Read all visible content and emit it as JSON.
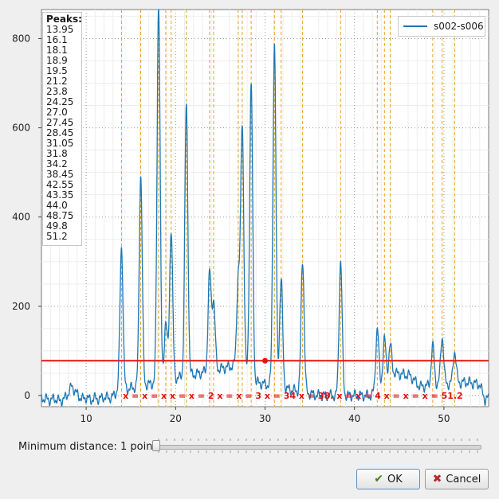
{
  "chart_data": {
    "type": "line",
    "series": [
      {
        "name": "s002-s006",
        "color": "#1f77b4"
      }
    ],
    "xlim": [
      5,
      55
    ],
    "ylim": [
      -25,
      865
    ],
    "x_ticks": [
      10,
      20,
      30,
      40,
      50
    ],
    "y_ticks": [
      0,
      200,
      400,
      600,
      800
    ],
    "grid": true,
    "legend_position": "top-right",
    "threshold": 78,
    "threshold_marker_x": 30,
    "threshold_color": "#e8140f",
    "peak_line_color": "#e6a21c",
    "baseline_points": [
      [
        5,
        -5
      ],
      [
        5.5,
        -8
      ],
      [
        6,
        -10
      ],
      [
        6.5,
        -7
      ],
      [
        7,
        -12
      ],
      [
        7.5,
        -9
      ],
      [
        8,
        5
      ],
      [
        8.4,
        22
      ],
      [
        8.8,
        8
      ],
      [
        9.2,
        -2
      ],
      [
        9.6,
        -8
      ],
      [
        10,
        -4
      ],
      [
        10.5,
        -10
      ],
      [
        11,
        -6
      ],
      [
        11.5,
        -8
      ],
      [
        12,
        -3
      ],
      [
        12.5,
        -6
      ],
      [
        13,
        -2
      ],
      [
        13.5,
        10
      ],
      [
        27.3,
        70
      ],
      [
        28.9,
        30
      ],
      [
        40.2,
        -18
      ],
      [
        41.2,
        -12
      ],
      [
        44.5,
        50
      ],
      [
        46.2,
        45
      ],
      [
        47.3,
        20
      ],
      [
        52.5,
        30
      ],
      [
        54,
        25
      ],
      [
        54.6,
        -10
      ],
      [
        55,
        -5
      ]
    ],
    "peaks": [
      {
        "x": 13.95,
        "y": 330
      },
      {
        "x": 16.1,
        "y": 480
      },
      {
        "x": 18.1,
        "y": 860
      },
      {
        "x": 18.9,
        "y": 140
      },
      {
        "x": 19.5,
        "y": 345
      },
      {
        "x": 21.2,
        "y": 615
      },
      {
        "x": 23.8,
        "y": 225
      },
      {
        "x": 24.25,
        "y": 160
      },
      {
        "x": 27.0,
        "y": 200
      },
      {
        "x": 27.45,
        "y": 550
      },
      {
        "x": 28.45,
        "y": 665
      },
      {
        "x": 31.05,
        "y": 775
      },
      {
        "x": 31.8,
        "y": 250
      },
      {
        "x": 34.2,
        "y": 305
      },
      {
        "x": 38.45,
        "y": 310
      },
      {
        "x": 42.55,
        "y": 145
      },
      {
        "x": 43.35,
        "y": 105
      },
      {
        "x": 44.0,
        "y": 80
      },
      {
        "x": 48.75,
        "y": 95
      },
      {
        "x": 49.8,
        "y": 115
      },
      {
        "x": 51.2,
        "y": 80
      }
    ],
    "peaks_title": "Peaks:",
    "peak_labels": [
      "13.95",
      "16.1",
      "18.1",
      "18.9",
      "19.5",
      "21.2",
      "23.8",
      "24.25",
      "27.0",
      "27.45",
      "28.45",
      "31.05",
      "31.8",
      "34.2",
      "38.45",
      "42.55",
      "43.35",
      "44.0",
      "48.75",
      "49.8",
      "51.2"
    ],
    "x_markers_text": "x = x = x x = x = 2 x = x = 3 x = 34 x = 38. x = x = 4 x = x = x = 51.2"
  },
  "legend": {
    "label": "s002-s006"
  },
  "slider": {
    "label": "Minimum distance: 1 point"
  },
  "buttons": {
    "ok": "OK",
    "cancel": "Cancel"
  }
}
